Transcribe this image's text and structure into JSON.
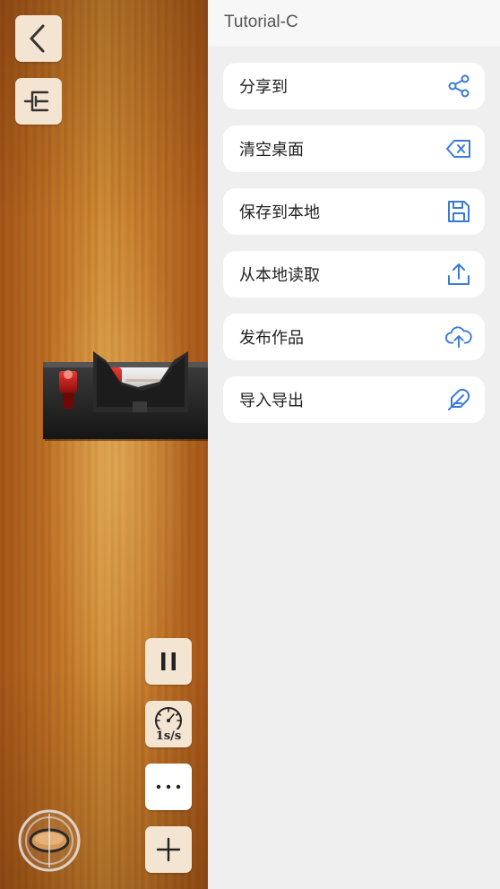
{
  "panel": {
    "title": "Tutorial-C",
    "menu": [
      {
        "label": "分享到",
        "icon": "share-icon"
      },
      {
        "label": "清空桌面",
        "icon": "clear-icon"
      },
      {
        "label": "保存到本地",
        "icon": "save-icon"
      },
      {
        "label": "从本地读取",
        "icon": "upload-icon"
      },
      {
        "label": "发布作品",
        "icon": "cloud-upload-icon"
      },
      {
        "label": "导入导出",
        "icon": "feather-icon"
      }
    ]
  },
  "toolbar": {
    "speed_label": "1s/s"
  },
  "colors": {
    "accent": "#3a7ad6",
    "button_bg": "#f4e4d2",
    "panel_bg": "#efefef"
  }
}
